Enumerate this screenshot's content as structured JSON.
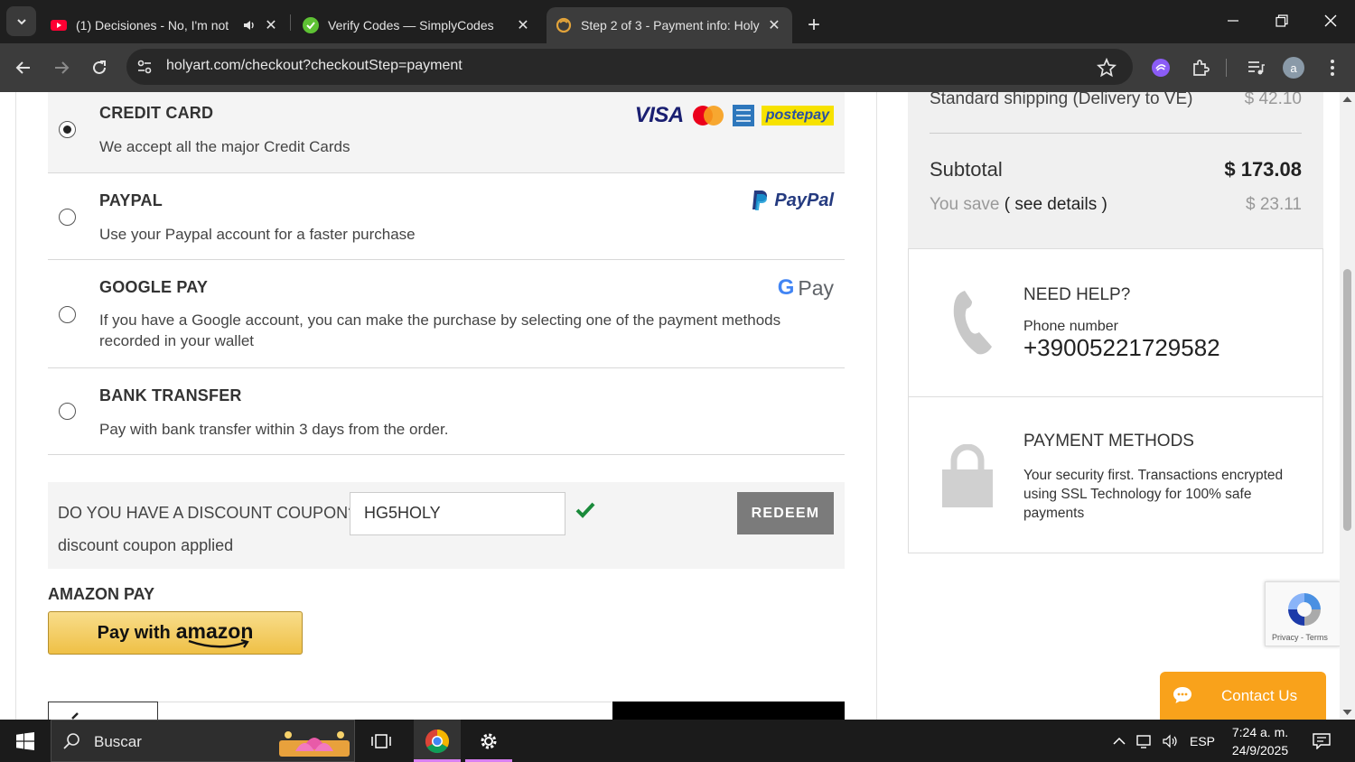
{
  "browser": {
    "tabs": [
      {
        "title": "(1) Decisiones - No, I'm not",
        "active": false,
        "audio": true
      },
      {
        "title": "Verify Codes — SimplyCodes",
        "active": false
      },
      {
        "title": "Step 2 of 3 - Payment info: Holy",
        "active": true
      }
    ],
    "url": "holyart.com/checkout?checkoutStep=payment",
    "profile_initial": "a"
  },
  "payment_methods": [
    {
      "title": "CREDIT CARD",
      "desc": "We accept all the major Credit Cards",
      "selected": true,
      "logos": [
        "VISA",
        "postepay"
      ]
    },
    {
      "title": "PAYPAL",
      "desc": "Use your Paypal account for a faster purchase",
      "selected": false,
      "logo_text": "PayPal"
    },
    {
      "title": "GOOGLE PAY",
      "desc": "If you have a Google account, you can make the purchase by selecting one of the payment methods recorded in your wallet",
      "selected": false,
      "logo_text": "Pay",
      "logo_g": "G"
    },
    {
      "title": "BANK TRANSFER",
      "desc": "Pay with bank transfer within 3 days from the order.",
      "selected": false
    }
  ],
  "coupon": {
    "question": "DO YOU HAVE A DISCOUNT COUPON?",
    "code": "HG5HOLY",
    "redeem": "REDEEM",
    "status": "discount coupon applied"
  },
  "amazon": {
    "title": "AMAZON PAY",
    "button_prefix": "Pay with",
    "button_brand": "amazon"
  },
  "summary": {
    "shipping_label": "Standard shipping (Delivery to VE)",
    "shipping_value": "$ 42.10",
    "subtotal_label": "Subtotal",
    "subtotal_value": "$ 173.08",
    "save_label": "You save",
    "save_link": "( see details )",
    "save_value": "$ 23.11"
  },
  "help": {
    "title": "NEED HELP?",
    "phone_label": "Phone number",
    "phone": "+39005221729582"
  },
  "payinfo": {
    "title": "PAYMENT METHODS",
    "desc": "Your security first. Transactions encrypted using SSL Technology for 100% safe payments"
  },
  "recaptcha": {
    "links": "Privacy - Terms"
  },
  "contact": {
    "label": "Contact Us"
  },
  "taskbar": {
    "search": "Buscar",
    "lang": "ESP",
    "time": "7:24 a. m.",
    "date": "24/9/2025"
  },
  "colors": {
    "accent_contact": "#f9a21b",
    "check_green": "#1a8a3a",
    "redeem_bg": "#7b7b7b"
  }
}
